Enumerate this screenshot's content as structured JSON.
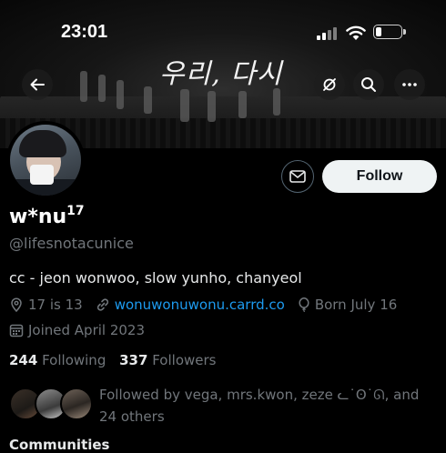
{
  "status_bar": {
    "time": "23:01"
  },
  "banner": {
    "title": "우리, 다시"
  },
  "profile": {
    "display_name": "w*nu",
    "display_name_sup": "17",
    "handle": "@lifesnotacunice",
    "bio": "cc - jeon wonwoo, slow yunho, chanyeol",
    "location": "17 is 13",
    "website": "wonuwonuwonu.carrd.co",
    "birthday": "Born July 16",
    "joined": "Joined April 2023",
    "following_count": "244",
    "following_label": "Following",
    "followers_count": "337",
    "followers_label": "Followers",
    "followed_by": "Followed by vega, mrs.kwon, zeze ᓚ˙ʘ˙ᘏ, and 24 others"
  },
  "buttons": {
    "follow": "Follow"
  },
  "bottom": {
    "partial_text": "Communities"
  },
  "icons": {
    "back": "back-arrow-icon",
    "no_notifications": "notification-off-icon",
    "search": "search-icon",
    "more": "more-icon",
    "message": "message-icon",
    "location": "location-icon",
    "link": "link-icon",
    "birthday": "balloon-icon",
    "calendar": "calendar-icon"
  },
  "colors": {
    "link": "#1d9bf0",
    "muted": "#71767b",
    "follow_bg": "#eff3f4"
  }
}
